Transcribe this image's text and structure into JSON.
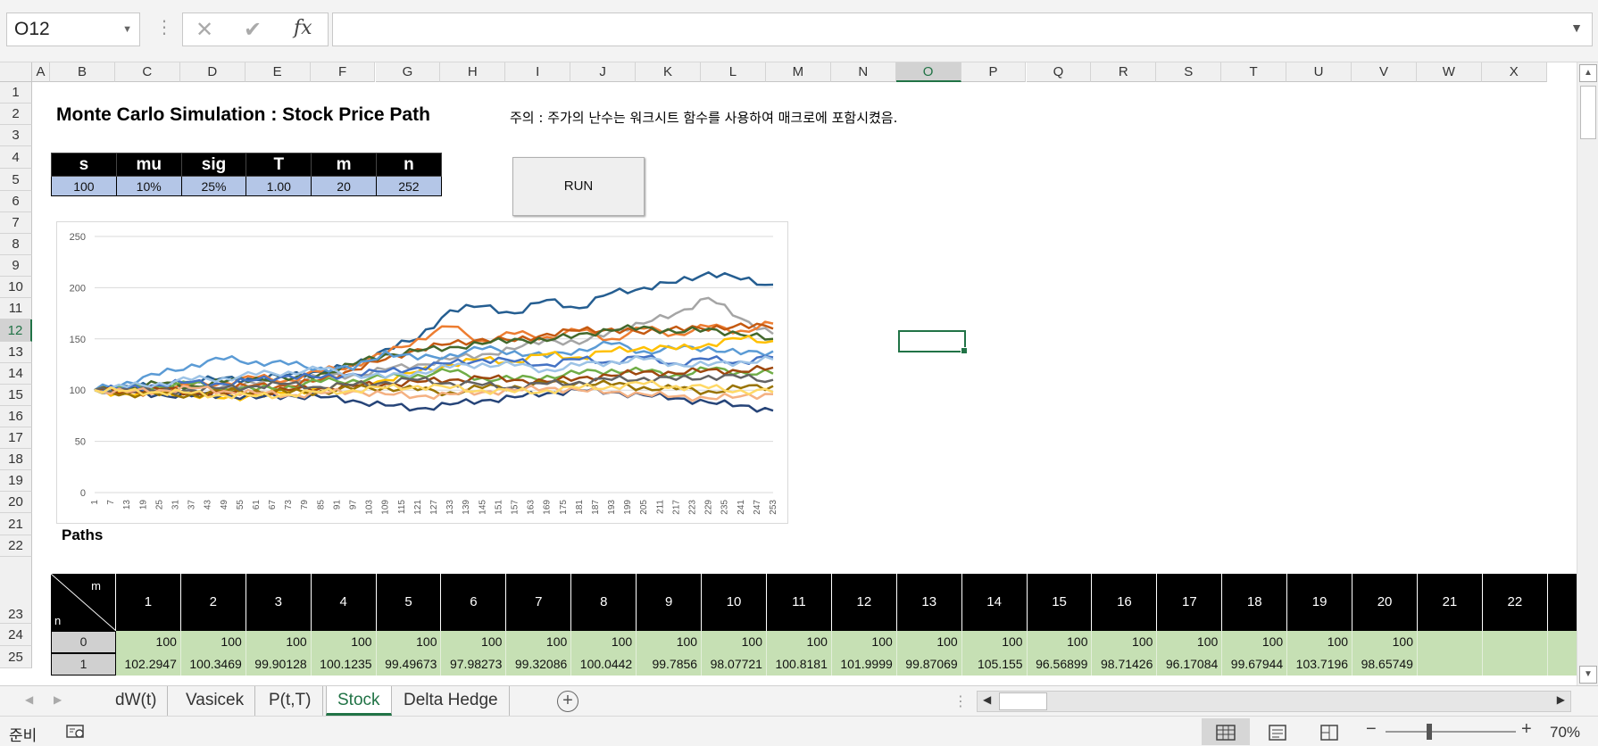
{
  "formula_bar": {
    "name_box": "O12",
    "cancel_icon": "x-icon",
    "enter_icon": "check-icon",
    "fx_label": "fx",
    "formula": ""
  },
  "columns": [
    "A",
    "B",
    "C",
    "D",
    "E",
    "F",
    "G",
    "H",
    "I",
    "J",
    "K",
    "L",
    "M",
    "N",
    "O",
    "P",
    "Q",
    "R",
    "S",
    "T",
    "U",
    "V",
    "W",
    "X"
  ],
  "selected_column": "O",
  "rows": [
    "1",
    "2",
    "3",
    "4",
    "5",
    "6",
    "7",
    "8",
    "9",
    "10",
    "11",
    "12",
    "13",
    "14",
    "15",
    "16",
    "17",
    "18",
    "19",
    "20",
    "21",
    "22",
    "23",
    "24",
    "25"
  ],
  "selected_row": "12",
  "sheet": {
    "title": "Monte Carlo Simulation : Stock Price Path",
    "note": "주의 : 주가의 난수는 워크시트 함수를 사용하여 매크로에 포함시켰음.",
    "params_headers": [
      "s",
      "mu",
      "sig",
      "T",
      "m",
      "n"
    ],
    "params_values": [
      "100",
      "10%",
      "25%",
      "1.00",
      "20",
      "252"
    ],
    "run_button": "RUN",
    "paths_label": "Paths",
    "paths_table": {
      "corner_m": "m",
      "corner_n": "n",
      "headers": [
        "1",
        "2",
        "3",
        "4",
        "5",
        "6",
        "7",
        "8",
        "9",
        "10",
        "11",
        "12",
        "13",
        "14",
        "15",
        "16",
        "17",
        "18",
        "19",
        "20",
        "21",
        "22"
      ],
      "rows": [
        {
          "n": "0",
          "values": [
            "100",
            "100",
            "100",
            "100",
            "100",
            "100",
            "100",
            "100",
            "100",
            "100",
            "100",
            "100",
            "100",
            "100",
            "100",
            "100",
            "100",
            "100",
            "100",
            "100",
            "",
            ""
          ]
        },
        {
          "n": "1",
          "values": [
            "102.2947",
            "100.3469",
            "99.90128",
            "100.1235",
            "99.49673",
            "97.98273",
            "99.32086",
            "100.0442",
            "99.7856",
            "98.07721",
            "100.8181",
            "101.9999",
            "99.87069",
            "105.155",
            "96.56899",
            "98.71426",
            "96.17084",
            "99.67944",
            "103.7196",
            "98.65749",
            "",
            ""
          ]
        }
      ]
    }
  },
  "chart_data": {
    "type": "line",
    "title": "",
    "xlabel": "",
    "ylabel": "",
    "ylim": [
      0,
      250
    ],
    "yticks": [
      "0",
      "50",
      "100",
      "150",
      "200",
      "250"
    ],
    "xticks": [
      "1",
      "7",
      "13",
      "19",
      "25",
      "31",
      "37",
      "43",
      "49",
      "55",
      "61",
      "67",
      "73",
      "79",
      "85",
      "91",
      "97",
      "103",
      "109",
      "115",
      "121",
      "127",
      "133",
      "139",
      "145",
      "151",
      "157",
      "163",
      "169",
      "175",
      "181",
      "187",
      "193",
      "199",
      "205",
      "211",
      "217",
      "223",
      "229",
      "235",
      "241",
      "247",
      "253"
    ],
    "x": [
      1,
      13,
      25,
      37,
      49,
      61,
      73,
      85,
      97,
      109,
      121,
      133,
      145,
      157,
      169,
      181,
      193,
      205,
      217,
      229,
      241,
      253
    ],
    "grid": true,
    "legend": "none",
    "series": [
      {
        "color": "#255e91",
        "values": [
          100,
          104,
          103,
          108,
          112,
          110,
          115,
          118,
          124,
          140,
          150,
          178,
          182,
          175,
          188,
          180,
          195,
          200,
          205,
          215,
          208,
          203
        ]
      },
      {
        "color": "#a5a5a5",
        "values": [
          100,
          98,
          102,
          100,
          104,
          106,
          110,
          112,
          115,
          120,
          125,
          130,
          135,
          140,
          150,
          145,
          158,
          165,
          175,
          190,
          170,
          155
        ]
      },
      {
        "color": "#ed7d31",
        "values": [
          100,
          101,
          98,
          105,
          108,
          112,
          110,
          118,
          125,
          135,
          150,
          162,
          148,
          155,
          152,
          158,
          150,
          160,
          155,
          162,
          158,
          165
        ]
      },
      {
        "color": "#c55a11",
        "values": [
          100,
          97,
          99,
          96,
          101,
          105,
          104,
          110,
          120,
          130,
          140,
          145,
          150,
          148,
          155,
          158,
          160,
          155,
          162,
          158,
          165,
          160
        ]
      },
      {
        "color": "#43682b",
        "values": [
          100,
          103,
          106,
          104,
          108,
          112,
          110,
          116,
          125,
          135,
          138,
          142,
          145,
          150,
          148,
          155,
          158,
          162,
          156,
          160,
          154,
          150
        ]
      },
      {
        "color": "#5b9bd5",
        "values": [
          100,
          108,
          115,
          125,
          130,
          128,
          125,
          122,
          120,
          138,
          130,
          135,
          140,
          138,
          132,
          140,
          145,
          138,
          140,
          142,
          135,
          138
        ]
      },
      {
        "color": "#ffc000",
        "values": [
          100,
          96,
          98,
          95,
          92,
          95,
          98,
          102,
          105,
          110,
          118,
          125,
          130,
          128,
          135,
          132,
          138,
          142,
          140,
          145,
          150,
          148
        ]
      },
      {
        "color": "#264478",
        "values": [
          100,
          98,
          96,
          94,
          96,
          92,
          95,
          93,
          90,
          85,
          82,
          86,
          90,
          93,
          97,
          100,
          98,
          95,
          92,
          88,
          85,
          80
        ]
      },
      {
        "color": "#70ad47",
        "values": [
          100,
          102,
          104,
          106,
          102,
          100,
          104,
          108,
          110,
          112,
          115,
          118,
          112,
          110,
          114,
          116,
          120,
          118,
          115,
          120,
          118,
          116
        ]
      },
      {
        "color": "#4472c4",
        "values": [
          100,
          102,
          105,
          108,
          106,
          110,
          114,
          112,
          116,
          118,
          122,
          126,
          130,
          128,
          125,
          130,
          128,
          132,
          126,
          130,
          128,
          132
        ]
      },
      {
        "color": "#9e480e",
        "values": [
          100,
          99,
          101,
          98,
          96,
          98,
          100,
          102,
          104,
          106,
          108,
          110,
          112,
          110,
          108,
          112,
          114,
          118,
          116,
          120,
          118,
          122
        ]
      },
      {
        "color": "#997300",
        "values": [
          100,
          97,
          95,
          96,
          98,
          100,
          97,
          99,
          101,
          103,
          100,
          98,
          102,
          104,
          106,
          108,
          105,
          103,
          101,
          99,
          102,
          104
        ]
      },
      {
        "color": "#636363",
        "values": [
          100,
          101,
          99,
          100,
          102,
          104,
          106,
          103,
          105,
          108,
          110,
          107,
          105,
          103,
          106,
          108,
          110,
          112,
          110,
          114,
          112,
          110
        ]
      },
      {
        "color": "#f4b183",
        "values": [
          100,
          98,
          100,
          102,
          99,
          97,
          95,
          97,
          99,
          96,
          94,
          96,
          98,
          100,
          102,
          100,
          98,
          96,
          94,
          92,
          94,
          96
        ]
      },
      {
        "color": "#9dc3e6",
        "values": [
          100,
          103,
          107,
          110,
          112,
          115,
          118,
          120,
          116,
          112,
          118,
          122,
          126,
          124,
          120,
          124,
          128,
          130,
          126,
          124,
          128,
          130
        ]
      },
      {
        "color": "#ffd966",
        "values": [
          100,
          99,
          98,
          97,
          95,
          94,
          96,
          98,
          100,
          102,
          104,
          102,
          100,
          98,
          100,
          102,
          104,
          106,
          104,
          102,
          100,
          98
        ]
      }
    ]
  },
  "tabs": [
    "dW(t)",
    "Vasicek",
    "P(t,T)",
    "Stock",
    "Delta Hedge"
  ],
  "active_tab": "Stock",
  "status": {
    "ready": "준비",
    "zoom": "70%"
  }
}
